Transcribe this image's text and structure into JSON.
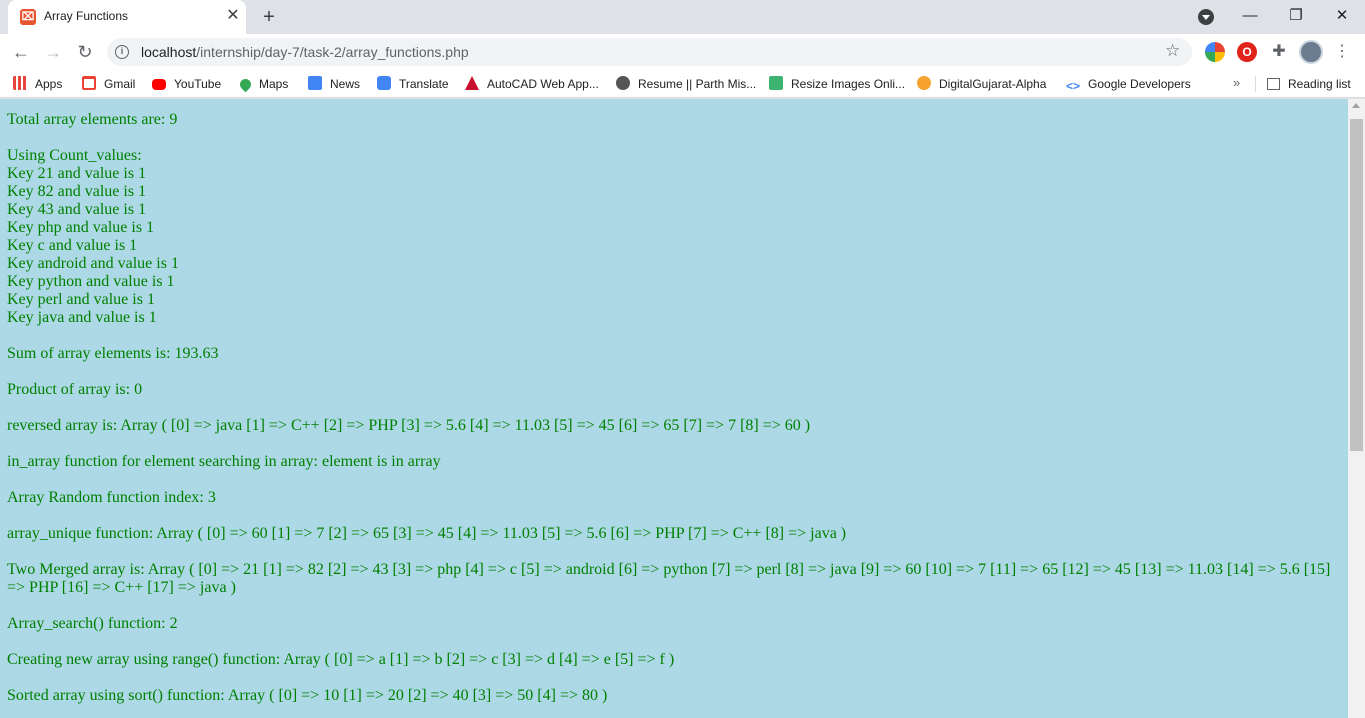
{
  "tab": {
    "title": "Array Functions",
    "favicon": "xampp-icon"
  },
  "toolbar": {
    "url_host": "localhost",
    "url_path": "/internship/day-7/task-2/array_functions.php"
  },
  "bookmarks": {
    "items": [
      {
        "label": "Apps",
        "icon": "apps-grid-icon"
      },
      {
        "label": "Gmail",
        "icon": "gmail-icon"
      },
      {
        "label": "YouTube",
        "icon": "youtube-icon"
      },
      {
        "label": "Maps",
        "icon": "maps-icon"
      },
      {
        "label": "News",
        "icon": "news-icon"
      },
      {
        "label": "Translate",
        "icon": "translate-icon"
      },
      {
        "label": "AutoCAD Web App...",
        "icon": "autocad-icon"
      },
      {
        "label": "Resume || Parth Mis...",
        "icon": "resume-icon"
      },
      {
        "label": "Resize Images Onli...",
        "icon": "resize-icon"
      },
      {
        "label": "DigitalGujarat-Alpha",
        "icon": "digitalgujarat-icon"
      },
      {
        "label": "Google Developers",
        "icon": "google-developers-icon"
      }
    ],
    "more": "»",
    "reading_list": "Reading list"
  },
  "page": {
    "total": "Total array elements are: 9",
    "count_values": {
      "heading": "Using Count_values:",
      "lines": [
        "Key 21 and value is 1",
        "Key 82 and value is 1",
        "Key 43 and value is 1",
        "Key php and value is 1",
        "Key c and value is 1",
        "Key android and value is 1",
        "Key python and value is 1",
        "Key perl and value is 1",
        "Key java and value is 1"
      ]
    },
    "sum": "Sum of array elements is: 193.63",
    "product": "Product of array is: 0",
    "reversed": "reversed array is: Array ( [0] => java [1] => C++ [2] => PHP [3] => 5.6 [4] => 11.03 [5] => 45 [6] => 65 [7] => 7 [8] => 60 )",
    "in_array": "in_array function for element searching in array: element is in array",
    "random": "Array Random function index: 3",
    "unique": "array_unique function: Array ( [0] => 60 [1] => 7 [2] => 65 [3] => 45 [4] => 11.03 [5] => 5.6 [6] => PHP [7] => C++ [8] => java )",
    "merged": "Two Merged array is: Array ( [0] => 21 [1] => 82 [2] => 43 [3] => php [4] => c [5] => android [6] => python [7] => perl [8] => java [9] => 60 [10] => 7 [11] => 65 [12] => 45 [13] => 11.03 [14] => 5.6 [15] => PHP [16] => C++ [17] => java )",
    "search": "Array_search() function: 2",
    "range": "Creating new array using range() function: Array ( [0] => a [1] => b [2] => c [3] => d [4] => e [5] => f )",
    "sorted": "Sorted array using sort() function: Array ( [0] => 10 [1] => 20 [2] => 40 [3] => 50 [4] => 80 )"
  },
  "colors": {
    "page_bg": "#add8e6",
    "text": "#008000"
  }
}
